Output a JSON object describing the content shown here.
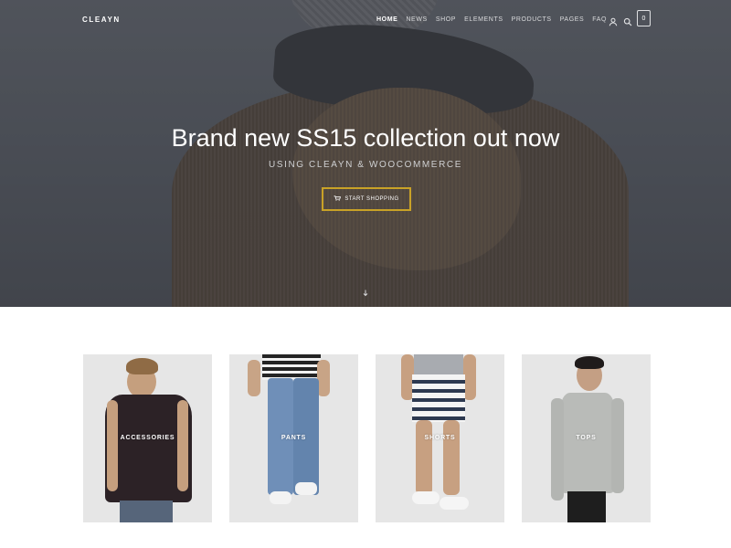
{
  "brand": {
    "logo": "CLEAYN"
  },
  "nav": {
    "items": [
      "HOME",
      "NEWS",
      "SHOP",
      "ELEMENTS",
      "PRODUCTS",
      "PAGES",
      "FAQ"
    ],
    "active": "HOME",
    "cart_count": "0",
    "icons": [
      "user-icon",
      "search-icon",
      "cart-icon"
    ]
  },
  "hero": {
    "headline": "Brand new SS15 collection out now",
    "subline": "USING CLEAYN & WOOCOMMERCE",
    "cta_label": "START SHOPPING",
    "cta_icon": "cart-icon",
    "scroll_icon": "scroll-down-icon",
    "accent_color": "#c9a227"
  },
  "categories": [
    {
      "label": "ACCESSORIES"
    },
    {
      "label": "PANTS"
    },
    {
      "label": "SHORTS"
    },
    {
      "label": "TOPS"
    }
  ]
}
